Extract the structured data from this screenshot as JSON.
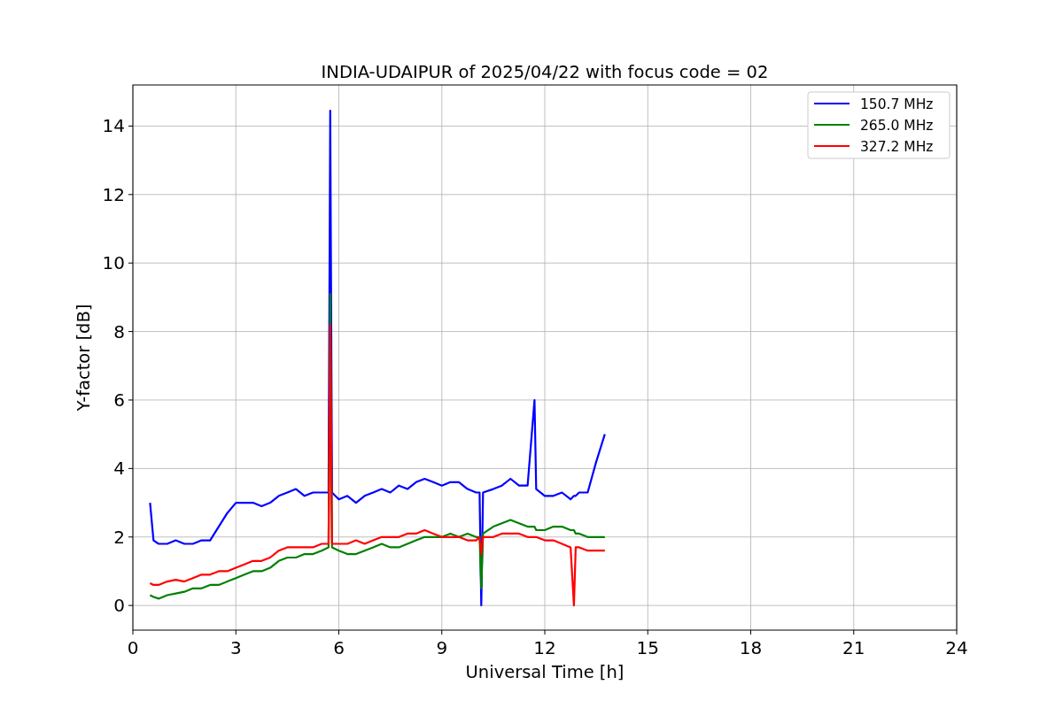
{
  "figure": {
    "chart_data": {
      "type": "line",
      "title": "INDIA-UDAIPUR of 2025/04/22 with focus code = 02",
      "xlabel": "Universal Time [h]",
      "ylabel": "Y-factor [dB]",
      "x": [
        0.5,
        0.6,
        0.75,
        1,
        1.25,
        1.5,
        1.75,
        2,
        2.25,
        2.5,
        2.75,
        3,
        3.25,
        3.5,
        3.75,
        4,
        4.25,
        4.5,
        4.75,
        5,
        5.25,
        5.5,
        5.7,
        5.75,
        5.8,
        6,
        6.25,
        6.5,
        6.75,
        7,
        7.25,
        7.5,
        7.75,
        8,
        8.25,
        8.5,
        8.75,
        9,
        9.25,
        9.5,
        9.75,
        10,
        10.1,
        10.15,
        10.2,
        10.5,
        10.75,
        11,
        11.25,
        11.5,
        11.7,
        11.75,
        12,
        12.25,
        12.5,
        12.75,
        12.85,
        12.9,
        13,
        13.25,
        13.5,
        13.75
      ],
      "series": [
        {
          "name": "150.7 MHz",
          "color": "#0000ff",
          "values": [
            3.0,
            1.9,
            1.8,
            1.8,
            1.9,
            1.8,
            1.8,
            1.9,
            1.9,
            2.3,
            2.7,
            3.0,
            3.0,
            3.0,
            2.9,
            3.0,
            3.2,
            3.3,
            3.4,
            3.2,
            3.3,
            3.3,
            3.3,
            14.45,
            3.3,
            3.1,
            3.2,
            3.0,
            3.2,
            3.3,
            3.4,
            3.3,
            3.5,
            3.4,
            3.6,
            3.7,
            3.6,
            3.5,
            3.6,
            3.6,
            3.4,
            3.3,
            3.3,
            0,
            3.3,
            3.4,
            3.5,
            3.7,
            3.5,
            3.5,
            6.0,
            3.4,
            3.2,
            3.2,
            3.3,
            3.1,
            3.2,
            3.2,
            3.3,
            3.3,
            4.2,
            5.0
          ]
        },
        {
          "name": "265.0 MHz",
          "color": "#008000",
          "values": [
            0.3,
            0.25,
            0.2,
            0.3,
            0.35,
            0.4,
            0.5,
            0.5,
            0.6,
            0.6,
            0.7,
            0.8,
            0.9,
            1.0,
            1.0,
            1.1,
            1.3,
            1.4,
            1.4,
            1.5,
            1.5,
            1.6,
            1.7,
            9.1,
            1.7,
            1.6,
            1.5,
            1.5,
            1.6,
            1.7,
            1.8,
            1.7,
            1.7,
            1.8,
            1.9,
            2.0,
            2.0,
            2.0,
            2.1,
            2.0,
            2.1,
            2.0,
            2.0,
            0.5,
            2.1,
            2.3,
            2.4,
            2.5,
            2.4,
            2.3,
            2.3,
            2.2,
            2.2,
            2.3,
            2.3,
            2.2,
            2.2,
            2.1,
            2.1,
            2.0,
            2.0,
            2.0
          ]
        },
        {
          "name": "327.2 MHz",
          "color": "#ff0000",
          "values": [
            0.65,
            0.6,
            0.6,
            0.7,
            0.75,
            0.7,
            0.8,
            0.9,
            0.9,
            1.0,
            1.0,
            1.1,
            1.2,
            1.3,
            1.3,
            1.4,
            1.6,
            1.7,
            1.7,
            1.7,
            1.7,
            1.8,
            1.8,
            8.2,
            1.8,
            1.8,
            1.8,
            1.9,
            1.8,
            1.9,
            2.0,
            2.0,
            2.0,
            2.1,
            2.1,
            2.2,
            2.1,
            2.0,
            2.0,
            2.0,
            1.9,
            1.9,
            2.0,
            1.5,
            2.0,
            2.0,
            2.1,
            2.1,
            2.1,
            2.0,
            2.0,
            2.0,
            1.9,
            1.9,
            1.8,
            1.7,
            0,
            1.7,
            1.7,
            1.6,
            1.6,
            1.6
          ]
        }
      ],
      "grid": true,
      "legend": true,
      "xlim": [
        0,
        24
      ],
      "ylim": [
        -0.72,
        15.2
      ],
      "xticks": [
        0,
        3,
        6,
        9,
        12,
        15,
        18,
        21,
        24
      ],
      "yticks": [
        0,
        2,
        4,
        6,
        8,
        10,
        12,
        14
      ]
    }
  }
}
